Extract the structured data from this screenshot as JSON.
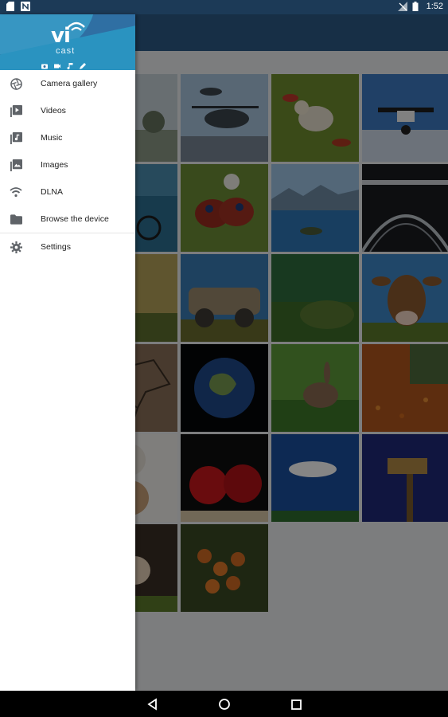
{
  "status_bar": {
    "time": "1:52",
    "left_icons": [
      "sd-card-icon",
      "notification-n-icon"
    ],
    "right_icons": [
      "no-signal-icon",
      "battery-icon"
    ]
  },
  "drawer": {
    "header": {
      "logo_main": "vi",
      "logo_sub": "cast",
      "quick_icons": [
        "camera-icon",
        "video-icon",
        "music-icon",
        "edit-icon"
      ]
    },
    "items": [
      {
        "label": "Camera gallery",
        "icon": "camera-aperture-icon"
      },
      {
        "label": "Videos",
        "icon": "video-library-icon"
      },
      {
        "label": "Music",
        "icon": "music-library-icon"
      },
      {
        "label": "Images",
        "icon": "image-library-icon"
      },
      {
        "label": "DLNA",
        "icon": "wifi-icon"
      },
      {
        "label": "Browse the device",
        "icon": "folder-icon"
      },
      {
        "label": "Settings",
        "icon": "gear-icon"
      }
    ]
  },
  "gallery": {
    "thumbnails": [
      "trees-landscape",
      "helicopter",
      "duckling-in-leaves",
      "drone",
      "bicycle-by-sea",
      "peacock-butterfly",
      "lake-mountains",
      "iron-bridge",
      "teddy-bear-field",
      "old-rusty-car",
      "moss-rock",
      "brown-cow",
      "cracked-earth",
      "earth-from-space",
      "rabbit-in-grass",
      "autumn-leaves",
      "white-teddy-bear",
      "red-apples",
      "blue-sky-clouds",
      "security-camera",
      "puppy",
      "red-currants"
    ]
  },
  "nav_bar": {
    "buttons": [
      "back-icon",
      "home-icon",
      "recents-icon"
    ]
  },
  "colors": {
    "status_bar": "#1c3a57",
    "toolbar": "#2c5a86",
    "drawer_header": "#2f6fa3",
    "drawer_accent": "#2a93c0",
    "menu_text": "#212121",
    "menu_icon": "#5f6368"
  }
}
